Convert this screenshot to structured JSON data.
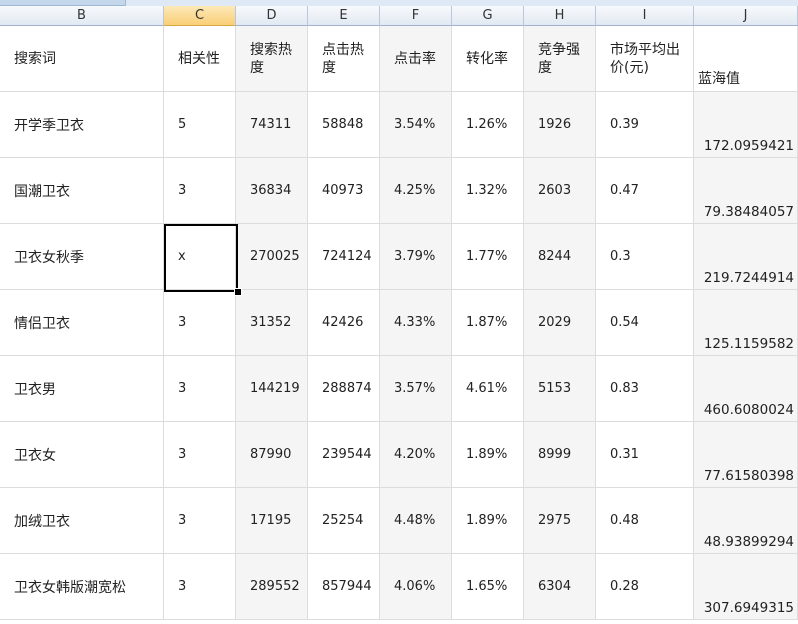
{
  "columns": [
    "B",
    "C",
    "D",
    "E",
    "F",
    "G",
    "H",
    "I",
    "J"
  ],
  "active_column": "C",
  "headers": {
    "B": "搜索词",
    "C": "相关性",
    "D": "搜索热度",
    "E": "点击热度",
    "F": "点击率",
    "G": "转化率",
    "H": "竞争强度",
    "I": "市场平均出价(元)",
    "J": "蓝海值"
  },
  "rows": [
    [
      "开学季卫衣",
      "5",
      "74311",
      "58848",
      "3.54%",
      "1.26%",
      "1926",
      "0.39",
      "172.0959421"
    ],
    [
      "国潮卫衣",
      "3",
      "36834",
      "40973",
      "4.25%",
      "1.32%",
      "2603",
      "0.47",
      "79.38484057"
    ],
    [
      "卫衣女秋季",
      "x",
      "270025",
      "724124",
      "3.79%",
      "1.77%",
      "8244",
      "0.3",
      "219.7244914"
    ],
    [
      "情侣卫衣",
      "3",
      "31352",
      "42426",
      "4.33%",
      "1.87%",
      "2029",
      "0.54",
      "125.1159582"
    ],
    [
      "卫衣男",
      "3",
      "144219",
      "288874",
      "3.57%",
      "4.61%",
      "5153",
      "0.83",
      "460.6080024"
    ],
    [
      "卫衣女",
      "3",
      "87990",
      "239544",
      "4.20%",
      "1.89%",
      "8999",
      "0.31",
      "77.61580398"
    ],
    [
      "加绒卫衣",
      "3",
      "17195",
      "25254",
      "4.48%",
      "1.89%",
      "2975",
      "0.48",
      "48.93899294"
    ],
    [
      "卫衣女韩版潮宽松",
      "3",
      "289552",
      "857944",
      "4.06%",
      "1.65%",
      "6304",
      "0.28",
      "307.6949315"
    ]
  ],
  "selected_cell": {
    "column": "C",
    "row_index": 2,
    "value": "x"
  }
}
